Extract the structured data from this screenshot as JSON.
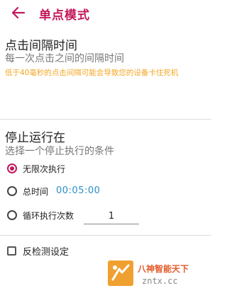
{
  "header": {
    "title": "单点模式",
    "back_icon": "arrow-left-icon",
    "accent": "#c2185b"
  },
  "interval": {
    "title": "点击间隔时间",
    "subtitle": "每一次点击之间的间隔时间",
    "warning": "低于40毫秒的点击间隔可能会导致您的设备卡住死机",
    "warning_color": "#f5a623"
  },
  "stop": {
    "title": "停止运行在",
    "subtitle": "选择一个停止执行的条件",
    "options": [
      {
        "label": "无限次执行",
        "selected": true
      },
      {
        "label": "总时间",
        "selected": false,
        "value": "00:05:00"
      },
      {
        "label": "循环执行次数",
        "selected": false,
        "value": "1"
      }
    ]
  },
  "anti_detect": {
    "label": "反检测设定",
    "checked": false
  },
  "watermark": {
    "name": "八神智能天下",
    "url": "zntx.cc"
  }
}
